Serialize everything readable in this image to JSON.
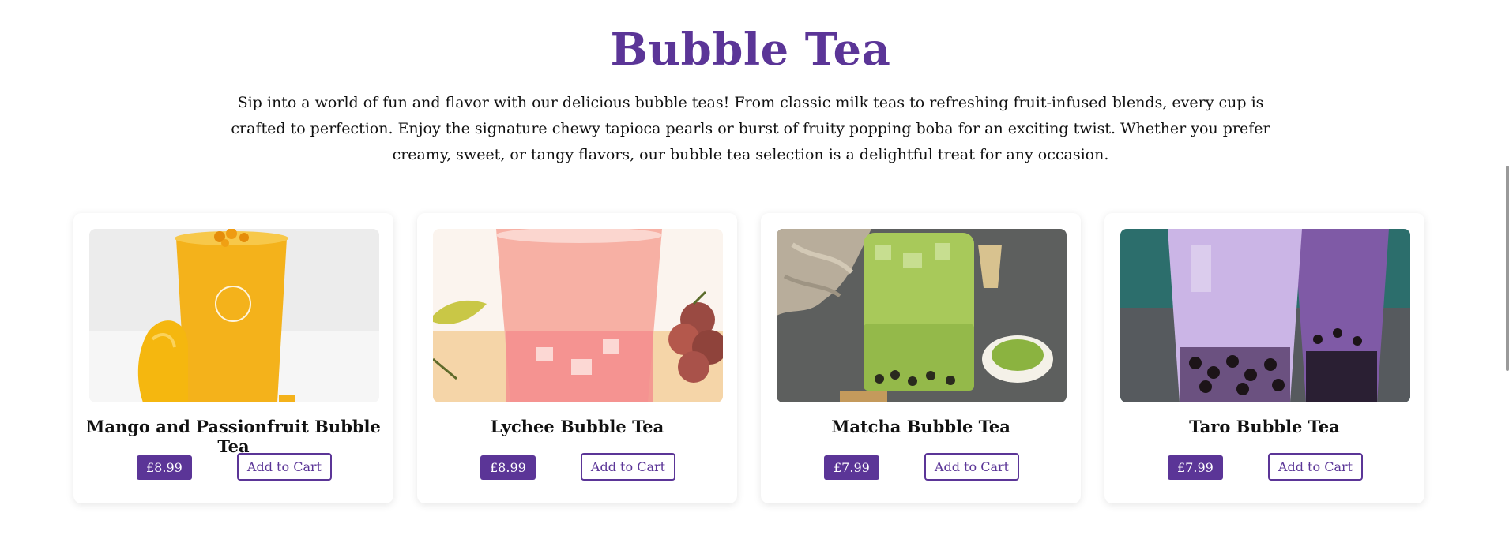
{
  "section": {
    "title": "Bubble Tea",
    "intro": "Sip into a world of fun and flavor with our delicious bubble teas! From classic milk teas to refreshing fruit-infused blends, every cup is crafted to perfection. Enjoy the signature chewy tapioca pearls or burst of fruity popping boba for an exciting twist. Whether you prefer creamy, sweet, or tangy flavors, our bubble tea selection is a delightful treat for any occasion."
  },
  "products": [
    {
      "name": "Mango and Passionfruit Bubble Tea",
      "price": "£8.99",
      "button": "Add to Cart",
      "image": "mango-bubble-tea-photo"
    },
    {
      "name": "Lychee Bubble Tea",
      "price": "£8.99",
      "button": "Add to Cart",
      "image": "lychee-bubble-tea-photo"
    },
    {
      "name": "Matcha Bubble Tea",
      "price": "£7.99",
      "button": "Add to Cart",
      "image": "matcha-bubble-tea-photo"
    },
    {
      "name": "Taro Bubble Tea",
      "price": "£7.99",
      "button": "Add to Cart",
      "image": "taro-bubble-tea-photo"
    }
  ],
  "colors": {
    "accent": "#5b3597",
    "text": "#111111",
    "background": "#ffffff"
  }
}
